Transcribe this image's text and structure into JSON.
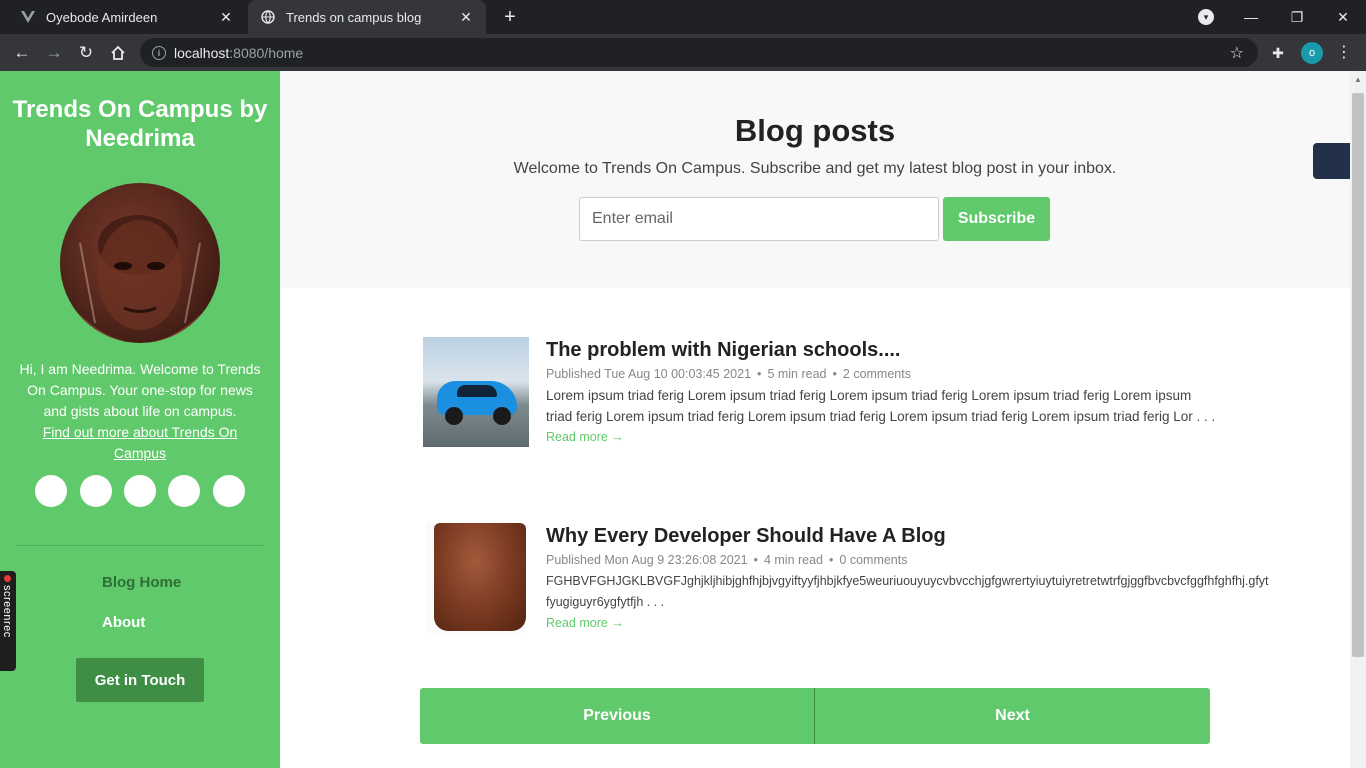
{
  "browser": {
    "tabs": [
      {
        "title": "Oyebode Amirdeen",
        "icon": "vue-icon"
      },
      {
        "title": "Trends on campus blog",
        "icon": "globe-icon"
      }
    ],
    "url_host": "localhost",
    "url_path": ":8080/home",
    "profile_initial": "o"
  },
  "sidebar": {
    "title": "Trends On Campus by Needrima",
    "bio": "Hi, I am Needrima. Welcome to Trends On Campus. Your one-stop for news and gists about life on campus.",
    "bio_link": "Find out more about Trends On Campus",
    "nav": [
      {
        "label": "Blog Home"
      },
      {
        "label": "About"
      }
    ],
    "cta": "Get in Touch"
  },
  "overlay": {
    "screenrec": "screenrec"
  },
  "hero": {
    "title": "Blog posts",
    "subtitle": "Welcome to Trends On Campus. Subscribe and get my latest blog post in your inbox.",
    "email_placeholder": "Enter email",
    "subscribe_label": "Subscribe"
  },
  "posts": [
    {
      "title": "The problem with Nigerian schools....",
      "published": "Published Tue Aug 10 00:03:45 2021",
      "read_time": "5 min read",
      "comments": "2 comments",
      "excerpt": "Lorem ipsum triad ferig Lorem ipsum triad ferig Lorem ipsum triad ferig Lorem ipsum triad ferig Lorem ipsum triad ferig Lorem ipsum triad ferig Lorem ipsum triad ferig Lorem ipsum triad ferig Lorem ipsum triad ferig Lor . . .",
      "read_more": "Read more →"
    },
    {
      "title": "Why Every Developer Should Have A Blog",
      "published": "Published Mon Aug 9 23:26:08 2021",
      "read_time": "4 min read",
      "comments": "0 comments",
      "excerpt": "FGHBVFGHJGKLBVGFJghjkljhibjghfhjbjvgyiftyyfjhbjkfye5weuriuouyuycvbvcchjgfgwrertyiuytuiyretretwtrfgjggfbvcbvcfggfhfghfhj.gfyt\nfyugiguyr6ygfytfjh . . .",
      "read_more": "Read more →"
    }
  ],
  "pager": {
    "previous": "Previous",
    "next": "Next"
  },
  "colors": {
    "accent": "#60c96b",
    "accent_dark": "#3e8e46"
  }
}
